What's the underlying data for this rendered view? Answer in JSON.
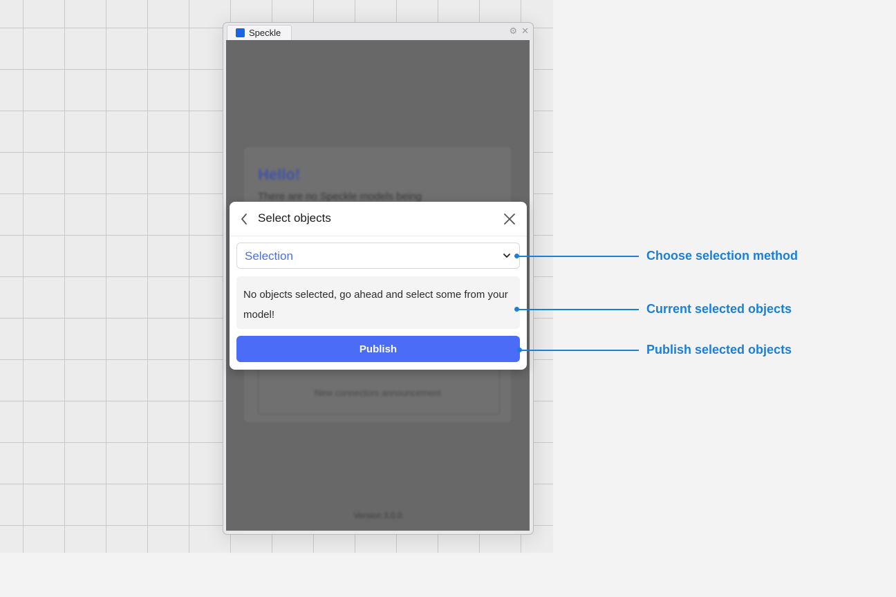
{
  "window": {
    "tab_title": "Speckle",
    "settings_icon": "gear-icon",
    "close_icon": "close-icon"
  },
  "background": {
    "hello": "Hello!",
    "intro_text": "There are no Speckle models being",
    "announcement": "New connectors announcement",
    "version": "Version 3.0.0"
  },
  "modal": {
    "title": "Select objects",
    "back_icon": "chevron-left-icon",
    "close_icon": "close-icon",
    "select_value": "Selection",
    "info_text": "No objects selected, go ahead and select some from your model!",
    "publish_label": "Publish"
  },
  "callouts": [
    {
      "label": "Choose selection method"
    },
    {
      "label": "Current selected objects"
    },
    {
      "label": "Publish selected objects"
    }
  ],
  "colors": {
    "accent": "#4a6cf7",
    "callout": "#1b7fd8",
    "select_text": "#4a6ee0"
  }
}
